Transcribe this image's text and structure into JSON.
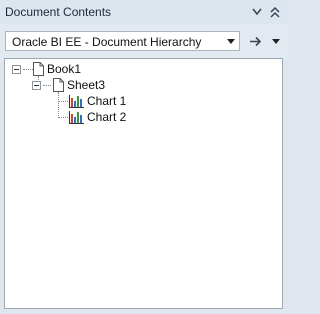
{
  "panel": {
    "title": "Document Contents"
  },
  "selector": {
    "value": "Oracle BI EE - Document Hierarchy"
  },
  "tree": {
    "root": {
      "label": "Book1",
      "icon": "document-icon"
    },
    "sheet": {
      "label": "Sheet3",
      "icon": "document-icon"
    },
    "charts": [
      {
        "label": "Chart 1",
        "icon": "bar-chart-icon"
      },
      {
        "label": "Chart 2",
        "icon": "bar-chart-icon"
      }
    ]
  },
  "colors": {
    "panel_bg": "#dfe6ee",
    "tree_bg": "#ffffff",
    "chart_bar_red": "#d9412b",
    "chart_bar_blue": "#2f6fc8",
    "chart_bar_green": "#3a9a3a"
  }
}
